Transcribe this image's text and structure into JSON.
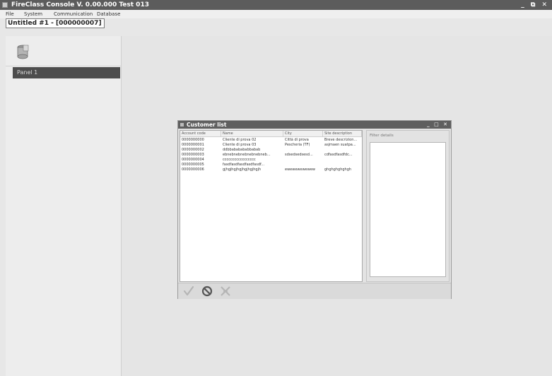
{
  "window": {
    "title": "FireClass Console V. 0.00.000 Test 013",
    "controls": "_ ⧉ ✕"
  },
  "menu": {
    "file": "File",
    "system": "System",
    "communication": "Communication",
    "database": "Database"
  },
  "document_tab": "Untitled #1 - [000000007]",
  "sidebar": {
    "icon": "database-icon",
    "panel_label": "Panel 1"
  },
  "customer_list": {
    "title": "Customer list",
    "controls": "_ □ ✕",
    "columns": [
      "Account code",
      "Name",
      "City",
      "Site description"
    ],
    "rows": [
      [
        "0000000000",
        "Cliente di prova 02",
        "Città di prova",
        "Breve descrizion..."
      ],
      [
        "0000000001",
        "Cliente di prova 03",
        "Pescheria (TF)",
        "asjmaen suatpa..."
      ],
      [
        "0000000002",
        "ddbbababababbabab",
        "",
        ""
      ],
      [
        "0000000003",
        "ebnebnebnebnebnebneb...",
        "sdsedsedsesd...",
        "cdfasdfasdfdc..."
      ],
      [
        "0000000004",
        "ccccccccccccccccc",
        "",
        ""
      ],
      [
        "0000000005",
        "fasdfasdfasdfasdfasdf...",
        "",
        ""
      ],
      [
        "0000000006",
        "gjhgjhgjhgjhgjhgjhgjh",
        "ewewewewewew",
        "ghghghghghgh"
      ]
    ],
    "filter_label": "Filter details",
    "bottom_icons": [
      "checkmark-icon",
      "cancel-icon",
      "disconnect-icon"
    ]
  },
  "colors": {
    "titlebar": "#5c5c5c",
    "panel_selected": "#4d4d4d",
    "workspace": "#e5e5e5"
  }
}
